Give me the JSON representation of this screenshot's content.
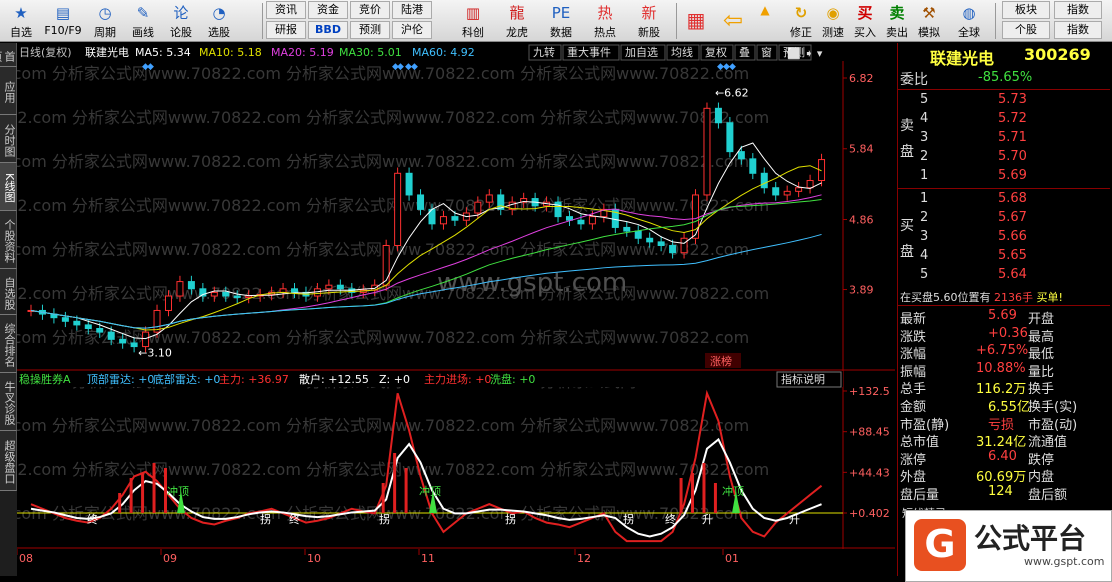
{
  "toolbar": {
    "items": [
      {
        "label": "自选",
        "icon": "star-icon"
      },
      {
        "label": "F10/F9",
        "icon": "f10-icon"
      },
      {
        "label": "周期",
        "icon": "clock-icon"
      },
      {
        "label": "画线",
        "icon": "pen-icon"
      },
      {
        "label": "论股",
        "icon": "forum-icon"
      },
      {
        "label": "选股",
        "icon": "select-stock-icon"
      }
    ],
    "tab_row1": [
      "资讯",
      "资金",
      "竞价",
      "陆港"
    ],
    "tab_row2": [
      "研报",
      "BBD",
      "预测",
      "沪伦"
    ],
    "items2": [
      {
        "label": "科创",
        "icon": "chart-icon"
      },
      {
        "label": "龙虎",
        "icon": "dragon-icon"
      },
      {
        "label": "数据",
        "icon": "pe-icon"
      },
      {
        "label": "热点",
        "icon": "hot-icon"
      },
      {
        "label": "新股",
        "icon": "newstock-icon"
      }
    ],
    "items3": [
      {
        "label": "修正",
        "icon": "fix-icon"
      },
      {
        "label": "测速",
        "icon": "speed-icon"
      },
      {
        "label": "买入",
        "icon": "buy-icon"
      },
      {
        "label": "卖出",
        "icon": "sell-icon"
      },
      {
        "label": "模拟",
        "icon": "auction-icon"
      },
      {
        "label": "全球",
        "icon": "globe-icon"
      }
    ],
    "right_tabs": [
      "板块",
      "指数"
    ],
    "right_tabs2": [
      "个股",
      "指数"
    ]
  },
  "sidebar": [
    "首页",
    "应用",
    "分时图",
    "K线图",
    "个股资料",
    "自选股",
    "综合排名",
    "牛叉诊股",
    "超级盘口"
  ],
  "watermark": "822.com 分析家公式网www.70822.com 分析家公式网www.70822.com 分析家公式网www.70822.com",
  "watermark2": "www.gspt.com",
  "kline": {
    "title_line": "日线(复权)",
    "stock_name": "联建光电",
    "ma5": "MA5: 5.34",
    "ma10": "MA10: 5.18",
    "ma20": "MA20: 5.19",
    "ma30": "MA30: 5.01",
    "ma60": "MA60: 4.92",
    "right_tags": [
      "九转",
      "重大事件",
      "加自选",
      "均线",
      "复权",
      "叠",
      "窗",
      "预测"
    ],
    "high_label": "6.62",
    "low_label": "3.10",
    "price_ticks": [
      "6.82",
      "5.84",
      "4.86",
      "3.89"
    ],
    "zhangbang": "涨榜"
  },
  "indicator": {
    "name": "稳操胜券A",
    "items": [
      "顶部雷达: +0",
      "底部雷达: +0",
      "主力: +36.97",
      "散户: +12.55",
      "Z: +0",
      "主力进场: +0",
      "洗盘: +0"
    ],
    "btn": "指标说明",
    "ticks": [
      "132.5",
      "88.45",
      "44.43",
      "0.402"
    ],
    "marks": [
      "冲顶",
      "冲顶",
      "冲顶",
      "冲顶",
      "顶",
      "拐",
      "终",
      "顶",
      "拐",
      "拐",
      "终",
      "拐",
      "升",
      "升"
    ]
  },
  "dates": [
    "08",
    "09",
    "10",
    "11",
    "12",
    "01"
  ],
  "quote": {
    "title": "联建光电",
    "code": "300269",
    "weibi_label": "委比",
    "weibi": "-85.65%",
    "sell_label": "卖盘",
    "buy_label": "买盘",
    "sell": [
      {
        "n": "5",
        "p": "5.73"
      },
      {
        "n": "4",
        "p": "5.72"
      },
      {
        "n": "3",
        "p": "5.71"
      },
      {
        "n": "2",
        "p": "5.70"
      },
      {
        "n": "1",
        "p": "5.69"
      }
    ],
    "buy": [
      {
        "n": "1",
        "p": "5.68"
      },
      {
        "n": "2",
        "p": "5.67"
      },
      {
        "n": "3",
        "p": "5.66"
      },
      {
        "n": "4",
        "p": "5.65"
      },
      {
        "n": "5",
        "p": "5.64"
      }
    ],
    "notice": "在买盘5.60位置有",
    "notice_vol": "2136手",
    "notice_end": "买单!",
    "stats": [
      [
        "最新",
        "5.69",
        "开盘",
        ""
      ],
      [
        "涨跌",
        "+0.36",
        "最高",
        ""
      ],
      [
        "涨幅",
        "+6.75%",
        "最低",
        ""
      ],
      [
        "振幅",
        "10.88%",
        "量比",
        ""
      ],
      [
        "总手",
        "116.2万",
        "换手",
        ""
      ],
      [
        "金额",
        "6.55亿",
        "换手(实)",
        ""
      ],
      [
        "市盈(静)",
        "亏损",
        "市盈(动)",
        ""
      ],
      [
        "总市值",
        "31.24亿",
        "流通值",
        ""
      ],
      [
        "涨停",
        "6.40",
        "跌停",
        ""
      ],
      [
        "外盘",
        "60.69万",
        "内盘",
        ""
      ],
      [
        "盘后量",
        "124",
        "盘后额",
        ""
      ]
    ],
    "footer": "短线精灵"
  },
  "logo": {
    "text": "公式平台",
    "url": "www.gspt.com"
  },
  "chart_data": {
    "type": "candlestick",
    "months": [
      "08",
      "09",
      "10",
      "11",
      "12",
      "01"
    ],
    "price_axis": [
      3.89,
      4.86,
      5.84,
      6.82
    ],
    "high": 6.62,
    "low": 3.1,
    "close_series": [
      3.6,
      3.55,
      3.5,
      3.45,
      3.4,
      3.35,
      3.3,
      3.2,
      3.15,
      3.1,
      3.3,
      3.6,
      3.8,
      4.0,
      3.9,
      3.8,
      3.85,
      3.8,
      3.78,
      3.8,
      3.82,
      3.85,
      3.9,
      3.85,
      3.8,
      3.9,
      3.95,
      3.9,
      3.85,
      3.88,
      3.95,
      4.5,
      5.5,
      5.2,
      5.0,
      4.8,
      4.9,
      4.85,
      4.95,
      5.1,
      5.2,
      5.0,
      5.1,
      5.15,
      5.05,
      5.1,
      4.9,
      4.85,
      4.8,
      4.9,
      5.0,
      4.75,
      4.7,
      4.6,
      4.55,
      4.5,
      4.4,
      4.6,
      5.2,
      6.4,
      6.2,
      5.8,
      5.7,
      5.5,
      5.3,
      5.2,
      5.25,
      5.3,
      5.4,
      5.69
    ]
  }
}
